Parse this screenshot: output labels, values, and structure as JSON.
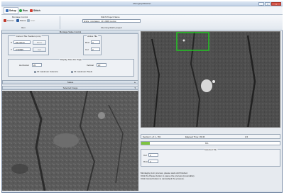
{
  "window": {
    "title": "MicrographStitcher"
  },
  "tabs": [
    {
      "label": "Setup",
      "active": true
    },
    {
      "label": "Run",
      "active": false
    },
    {
      "label": "Stitch",
      "active": false
    }
  ],
  "ribbon": {
    "montage_group_title": "Montage Control",
    "cancel_label": "Cancel",
    "pause_label": "Pause",
    "start_label": "Start",
    "run_group_label": "Run",
    "project_name_label": "Stitch Project Name",
    "project_name_value": "krahe_montage1_19_2008.montw",
    "running_project_label": "Running Stitch project"
  },
  "montage_controls": {
    "title": "Montage Value Control",
    "current_tile_title": "Current Tile Position (mm)",
    "x_label": "X",
    "x_value": "-33.26773",
    "y_label": "Y",
    "y_value": "-4.90636",
    "move_label": "Move",
    "get_label": "Get",
    "active_tile_title": "Active Tile",
    "row_label": "Row",
    "row_value": "3",
    "col_label": "Col",
    "col_value": "2"
  },
  "display_tiles": {
    "title": "Display Tiles Per Page",
    "horizontal_label": "Horizontal",
    "horizontal_value": "20",
    "vertical_label": "Vertical",
    "vertical_value": "20",
    "radio_columns_label": "Fit maximum Columns",
    "radio_pixels_label": "Fit maximum Pixels"
  },
  "status_bar_label": "Status",
  "selected_image_bar_label": "Selected Image",
  "progress": {
    "section_label": "Section 1 of 1 - 6%",
    "elapsed_label": "Elapsed Time: 03:46",
    "elapsed_fraction_label": "1/4",
    "bar_percent_label": "6%",
    "value": 0.06,
    "selected_tile_title": "Selected Tile",
    "col_label": "Col",
    "col_value": "2",
    "row_label": "Row",
    "row_value": "3",
    "message_line1": "Montaging is in process, please wait until finished.",
    "message_line2": "Click the Pause button to pause the process (resumable).",
    "message_line3": "Click Cancel button to cancel/quit the process."
  },
  "colors": {
    "accent": "#4a8fd8",
    "selection": "#22c322",
    "progress_fill": "#7ec43f"
  }
}
